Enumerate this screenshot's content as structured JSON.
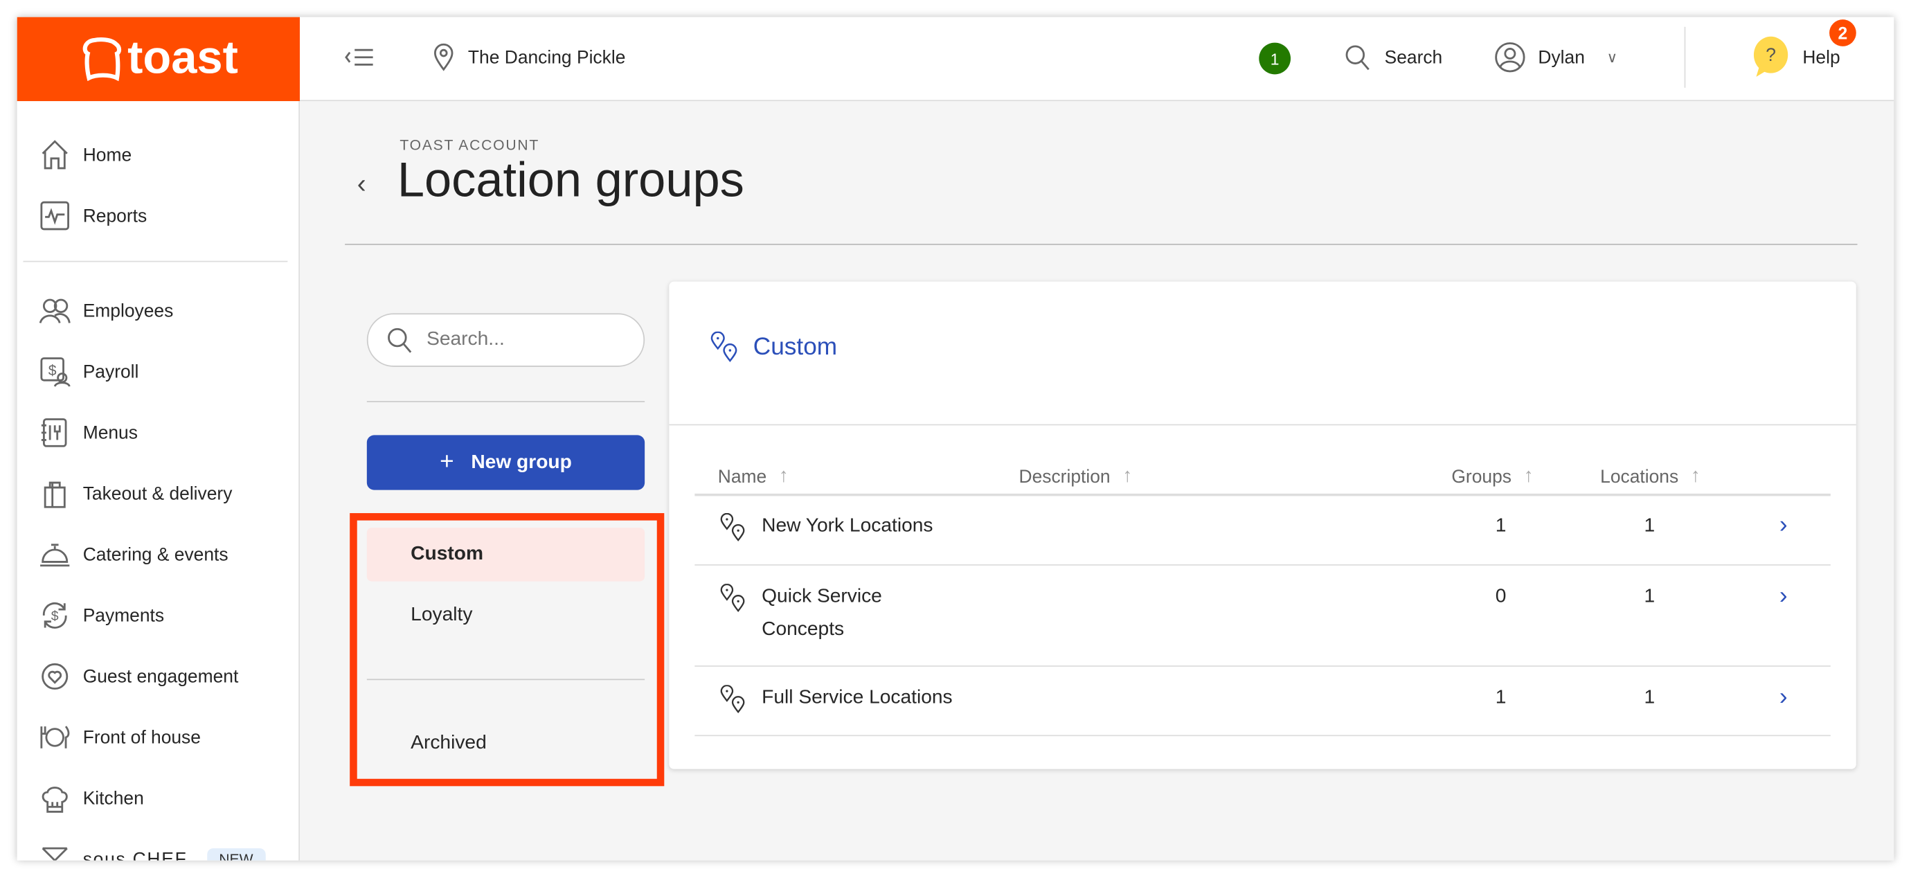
{
  "brand": {
    "name": "toast",
    "color": "#ff4c00"
  },
  "topbar": {
    "location": "The Dancing Pickle",
    "notification_count": "1",
    "search_label": "Search",
    "user": "Dylan",
    "help_label": "Help",
    "help_badge": "2"
  },
  "sidebar": {
    "items": [
      {
        "label": "Home",
        "icon": "home-icon"
      },
      {
        "label": "Reports",
        "icon": "reports-icon"
      },
      {
        "label": "Employees",
        "icon": "employees-icon"
      },
      {
        "label": "Payroll",
        "icon": "payroll-icon"
      },
      {
        "label": "Menus",
        "icon": "menus-icon"
      },
      {
        "label": "Takeout & delivery",
        "icon": "takeout-icon"
      },
      {
        "label": "Catering & events",
        "icon": "catering-icon"
      },
      {
        "label": "Payments",
        "icon": "payments-icon"
      },
      {
        "label": "Guest engagement",
        "icon": "guest-engagement-icon"
      },
      {
        "label": "Front of house",
        "icon": "front-of-house-icon"
      },
      {
        "label": "Kitchen",
        "icon": "kitchen-icon"
      },
      {
        "label": "sous CHEF",
        "icon": "chef-icon",
        "badge": "NEW"
      }
    ]
  },
  "page": {
    "eyebrow": "TOAST ACCOUNT",
    "title": "Location groups"
  },
  "groups_panel": {
    "search_placeholder": "Search...",
    "new_group_label": "New group",
    "categories": [
      "Custom",
      "Loyalty"
    ],
    "archived": "Archived",
    "selected": "Custom"
  },
  "card": {
    "title": "Custom",
    "columns": [
      "Name",
      "Description",
      "Groups",
      "Locations"
    ],
    "rows": [
      {
        "name_line1": "New York Locations",
        "name_line2": "",
        "description": "",
        "groups": "1",
        "locations": "1"
      },
      {
        "name_line1": "Quick Service",
        "name_line2": "Concepts",
        "description": "",
        "groups": "0",
        "locations": "1"
      },
      {
        "name_line1": "Full Service Locations",
        "name_line2": "",
        "description": "",
        "groups": "1",
        "locations": "1"
      }
    ]
  },
  "colors": {
    "accent": "#2b4fb9",
    "highlight": "#ff3b0a",
    "selected_bg": "#fde8e6",
    "notification": "#237a00"
  }
}
